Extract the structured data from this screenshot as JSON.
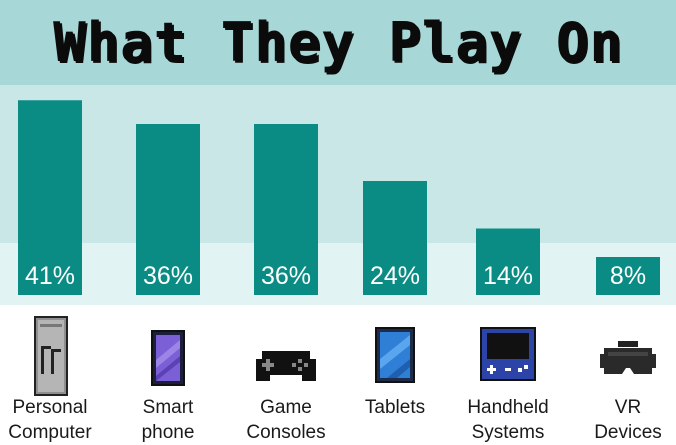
{
  "title": "What They Play On",
  "colors": {
    "bar": "#0a8c84",
    "value_text": "#ffffff",
    "band_title": "#a7d7d6",
    "band_mid": "#c9e7e6",
    "band_low": "#e1f3f2"
  },
  "chart_data": {
    "type": "bar",
    "title": "What They Play On",
    "xlabel": "",
    "ylabel": "",
    "unit": "%",
    "grid": false,
    "categories": [
      "Personal Computer",
      "Smart phone",
      "Game Consoles",
      "Tablets",
      "Handheld Systems",
      "VR Devices"
    ],
    "values": [
      41,
      36,
      36,
      24,
      14,
      8
    ],
    "value_labels": [
      "41%",
      "36%",
      "36%",
      "24%",
      "14%",
      "8%"
    ],
    "category_lines": [
      [
        "Personal",
        "Computer"
      ],
      [
        "Smart",
        "phone"
      ],
      [
        "Game",
        "Consoles"
      ],
      [
        "Tablets"
      ],
      [
        "Handheld",
        "Systems"
      ],
      [
        "VR",
        "Devices"
      ]
    ]
  },
  "icons": [
    "computer-tower-icon",
    "smartphone-icon",
    "gamepad-icon",
    "tablet-icon",
    "handheld-console-icon",
    "vr-headset-icon"
  ]
}
